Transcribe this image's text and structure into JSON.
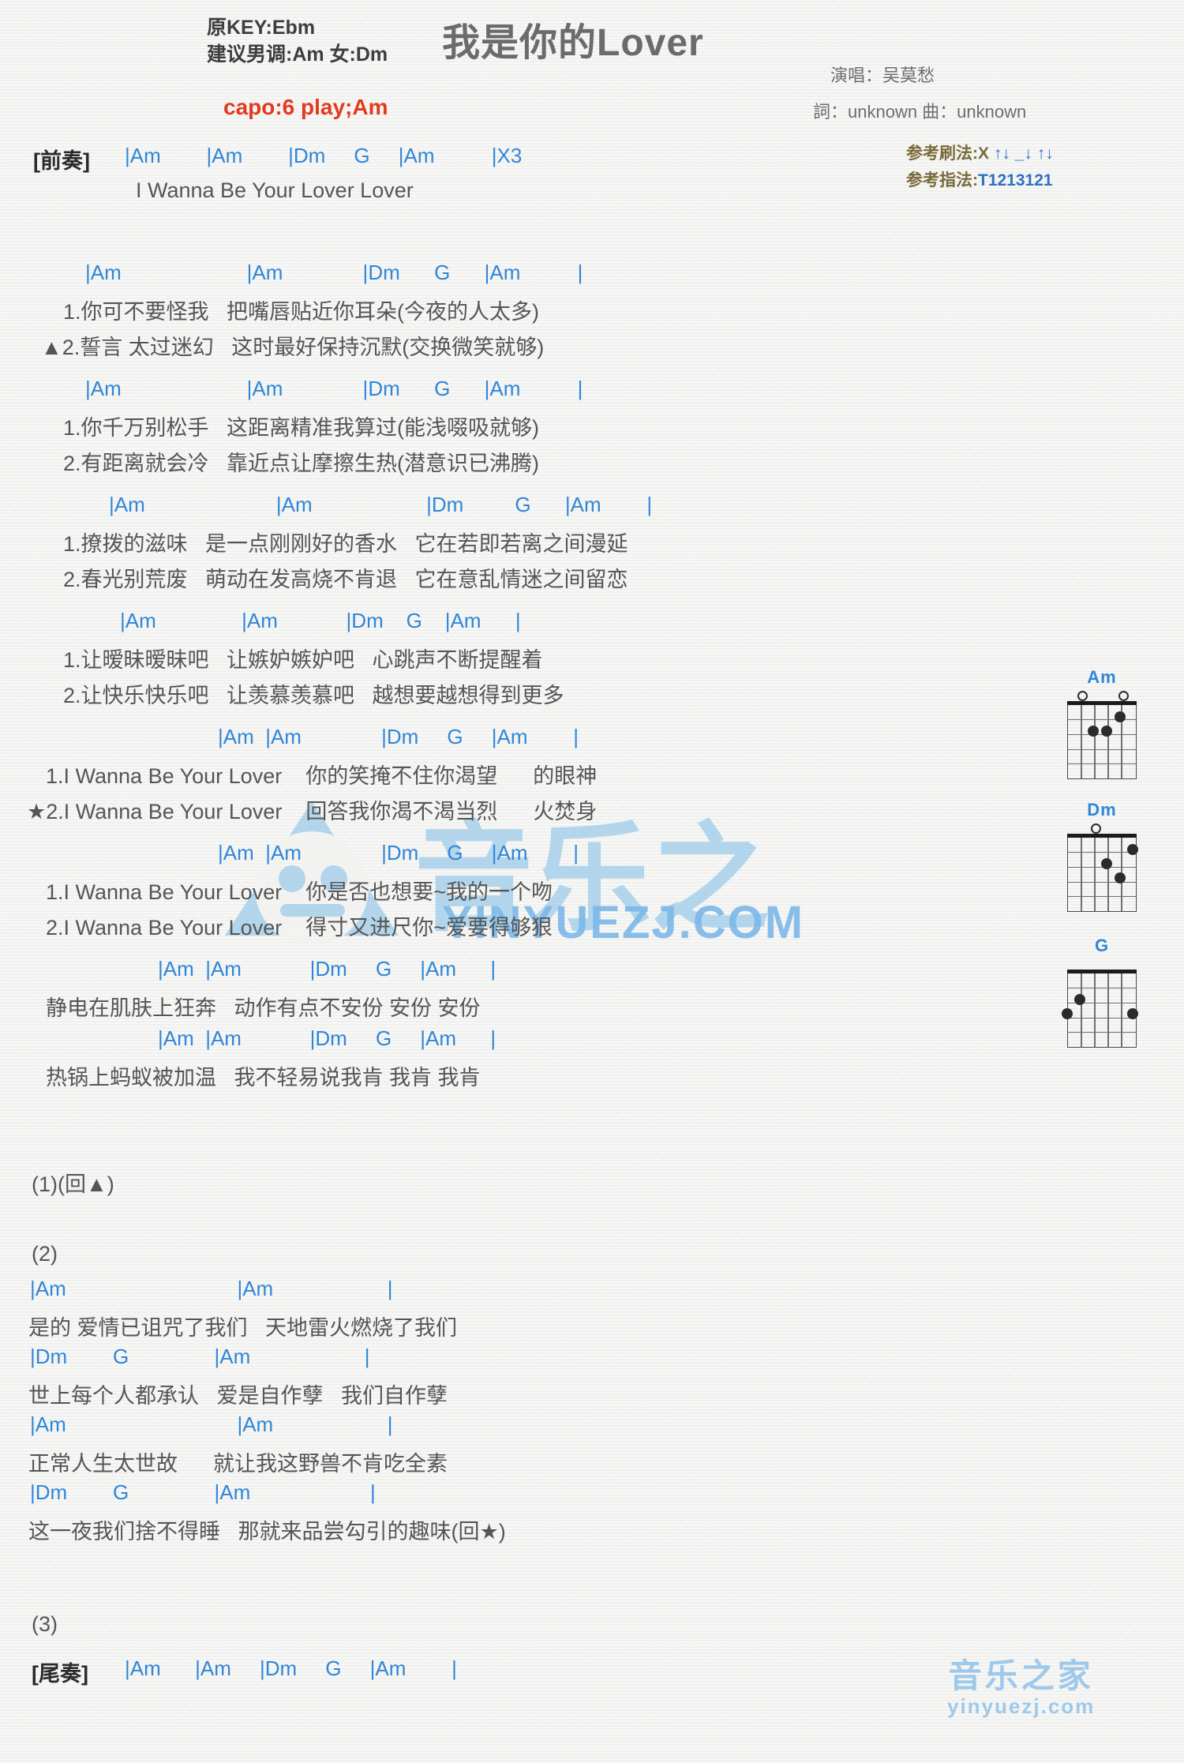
{
  "header": {
    "original_key": "原KEY:Ebm",
    "suggested_key": "建议男调:Am 女:Dm",
    "capo": "capo:6 play;Am",
    "title": "我是你的Lover",
    "singer": "演唱：吴莫愁",
    "credits": "詞：unknown   曲：unknown",
    "strum_label": "参考刷法:X",
    "strum_pattern": "↑↓ _↓ ↑↓",
    "pick_label": "参考指法:",
    "pick_pattern": "T1213121"
  },
  "intro": {
    "tag": "[前奏]",
    "chords": "|Am        |Am        |Dm     G     |Am          |X3",
    "lyric": "I Wanna Be Your Lover Lover"
  },
  "blocks": [
    {
      "chords": "|Am                      |Am              |Dm      G      |Am          |",
      "lines": [
        "1.你可不要怪我   把嘴唇贴近你耳朵(今夜的人太多)",
        "▲2.誓言 太过迷幻   这时最好保持沉默(交换微笑就够)"
      ]
    },
    {
      "chords": "|Am                      |Am              |Dm      G      |Am          |",
      "lines": [
        "1.你千万别松手   这距离精准我算过(能浅啜吸就够)",
        "2.有距离就会冷   靠近点让摩擦生热(潜意识已沸腾)"
      ]
    },
    {
      "chords": "|Am                       |Am                    |Dm         G      |Am        |",
      "lines": [
        "1.撩拨的滋味   是一点刚刚好的香水   它在若即若离之间漫延",
        "2.春光别荒废   萌动在发高烧不肯退   它在意乱情迷之间留恋"
      ]
    },
    {
      "chords": "|Am               |Am            |Dm    G    |Am      |",
      "lines": [
        "1.让暧昧暧昧吧   让嫉妒嫉妒吧   心跳声不断提醒着",
        "2.让快乐快乐吧   让羡慕羡慕吧   越想要越想得到更多"
      ]
    },
    {
      "chords": "|Am  |Am              |Dm     G     |Am        |",
      "lines": [
        "1.I Wanna Be Your Lover    你的笑掩不住你渴望      的眼神",
        "★2.I Wanna Be Your Lover    回答我你渴不渴当烈      火焚身"
      ]
    },
    {
      "chords": "|Am  |Am              |Dm     G     |Am        |",
      "lines": [
        "1.I Wanna Be Your Lover    你是否也想要~我的一个吻",
        "2.I Wanna Be Your Lover    得寸又进尺你~爱要得够狠"
      ]
    },
    {
      "chords": "|Am  |Am            |Dm     G     |Am      |",
      "lines": [
        "静电在肌肤上狂奔   动作有点不安份 安份 安份"
      ]
    },
    {
      "chords": "|Am  |Am            |Dm     G     |Am      |",
      "lines": [
        "热锅上蚂蚁被加温   我不轻易说我肯 我肯 我肯"
      ]
    }
  ],
  "repeat_one": "(1)(回▲)",
  "section_two_label": "(2)",
  "verse2": [
    {
      "chords": "|Am                              |Am                    |",
      "lyric": "是的 爱情已诅咒了我们   天地雷火燃烧了我们"
    },
    {
      "chords": "|Dm        G               |Am                    |",
      "lyric": "世上每个人都承认   爱是自作孽   我们自作孽"
    },
    {
      "chords": "|Am                              |Am                    |",
      "lyric": "正常人生太世故      就让我这野兽不肯吃全素"
    },
    {
      "chords": "|Dm        G               |Am                     |",
      "lyric": "这一夜我们捨不得睡   那就来品尝勾引的趣味(回★)"
    }
  ],
  "section_three_label": "(3)",
  "outro": {
    "tag": "[尾奏]",
    "chords": "|Am      |Am     |Dm     G     |Am        |"
  },
  "chord_diagrams": [
    {
      "name": "Am",
      "open_strings": [
        1,
        5
      ],
      "dots": [
        {
          "string": 2,
          "fret": 1
        },
        {
          "string": 3,
          "fret": 2
        },
        {
          "string": 4,
          "fret": 2
        }
      ]
    },
    {
      "name": "Dm",
      "open_strings": [
        3
      ],
      "dots": [
        {
          "string": 1,
          "fret": 1
        },
        {
          "string": 3,
          "fret": 2
        },
        {
          "string": 2,
          "fret": 3
        }
      ]
    },
    {
      "name": "G",
      "open_strings": [],
      "dots": [
        {
          "string": 5,
          "fret": 2
        },
        {
          "string": 6,
          "fret": 3
        },
        {
          "string": 1,
          "fret": 3
        }
      ]
    }
  ],
  "watermark": {
    "brand_cn": "音乐之家",
    "brand_domain": "YINYUEZJ.COM",
    "bottom_cn": "音乐之家",
    "bottom_en": "yinyuezj.com"
  }
}
